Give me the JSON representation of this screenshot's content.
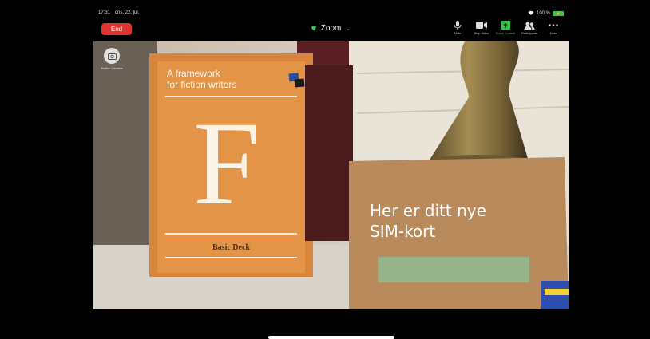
{
  "status_bar": {
    "time": "17:31",
    "date": "ons. 22. jul.",
    "battery_text": "100 %"
  },
  "meeting": {
    "end_label": "End",
    "title": "Zoom"
  },
  "controls": [
    {
      "name": "mute-button",
      "label": "Mute",
      "icon": "microphone-icon"
    },
    {
      "name": "stop-video-button",
      "label": "Stop Video",
      "icon": "video-camera-icon"
    },
    {
      "name": "share-content-button",
      "label": "Share Content",
      "icon": "share-screen-icon"
    },
    {
      "name": "participants-button",
      "label": "Participants",
      "icon": "participants-icon"
    },
    {
      "name": "more-button",
      "label": "More",
      "icon": "more-dots-icon"
    }
  ],
  "switch_camera": {
    "label": "Switch Camera"
  },
  "scene": {
    "book_line1": "A framework",
    "book_line2": "for fiction writers",
    "book_letter": "F",
    "book_footer": "Basic Deck",
    "card_line1": "Her er ditt nye",
    "card_line2": "SIM-kort"
  },
  "colors": {
    "end_red": "#e0342e",
    "accent_green": "#38c24a",
    "book_orange": "#e39447",
    "card_brown": "#b88a5c"
  }
}
